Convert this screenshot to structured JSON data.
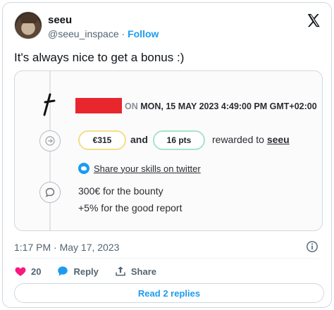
{
  "author": {
    "name": "seeu",
    "handle": "@seeu_inspace",
    "separator": "·",
    "follow_label": "Follow"
  },
  "tweet": {
    "text": "It's always nice to get a bonus :)",
    "timestamp": "1:17 PM · May 17, 2023"
  },
  "media": {
    "date_prefix": "ON",
    "date_text": "MON, 15 MAY 2023 4:49:00 PM GMT+02:00",
    "reward_amount": "€315",
    "conjunction": "and",
    "reward_points": "16 pts",
    "rewarded_to_label": "rewarded to",
    "rewarded_user": "seeu",
    "share_link_text": "Share your skills on twitter",
    "bounty_lines": [
      "300€ for the bounty",
      "+5% for the good report"
    ],
    "colors": {
      "redaction": "#e8262d",
      "money_pill_border": "#f4de86",
      "points_pill_border": "#a9e3cd"
    }
  },
  "actions": {
    "like_count": "20",
    "reply_label": "Reply",
    "share_label": "Share",
    "read_replies_label": "Read 2 replies"
  },
  "icons": {
    "brand": "x-logo-icon",
    "like": "heart-icon",
    "reply": "speech-bubble-icon",
    "share": "share-upload-icon",
    "info": "info-icon"
  },
  "colors": {
    "accent": "#1d9bf0",
    "like": "#f91880",
    "muted_text": "#536471"
  }
}
